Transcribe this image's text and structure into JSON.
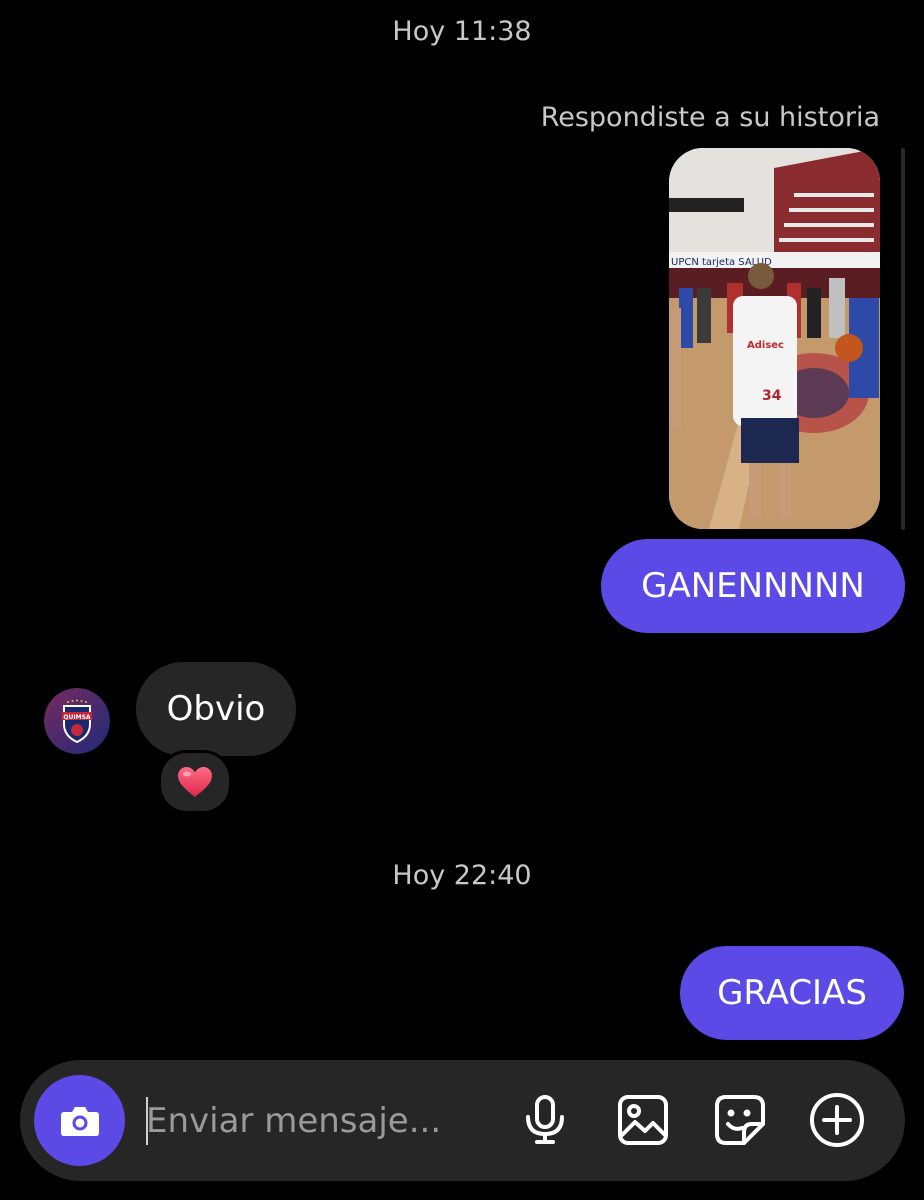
{
  "thread": {
    "timestamp_1": "Hoy 11:38",
    "reply_label": "Respondiste a su historia",
    "story_text": "UPCN tarjeta SALUD",
    "jersey_text": "Adisec",
    "jersey_number": "34",
    "sent_1": "GANENNNNN",
    "avatar_text": "QUIMSA",
    "received_1": "Obvio",
    "reaction": "heart",
    "timestamp_2": "Hoy 22:40",
    "sent_2": "GRACIAS"
  },
  "composer": {
    "placeholder": "Enviar mensaje...",
    "icons": [
      "camera-icon",
      "microphone-icon",
      "gallery-icon",
      "sticker-icon",
      "plus-circle-icon"
    ]
  },
  "colors": {
    "background": "#000000",
    "sent_bubble": "#5b4ae6",
    "received_bubble": "#262626",
    "timestamp": "#c8c8c8",
    "composer_bg": "#262626"
  }
}
